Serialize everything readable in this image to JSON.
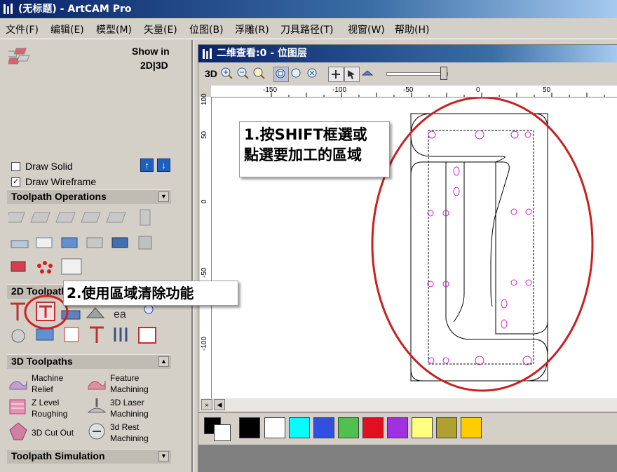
{
  "window": {
    "title": "(无标题) - ArtCAM Pro"
  },
  "menu": [
    "文件(F)",
    "编辑(E)",
    "模型(M)",
    "矢量(E)",
    "位图(B)",
    "浮雕(R)",
    "刀具路径(T)",
    "视窗(W)",
    "帮助(H)"
  ],
  "left_panel": {
    "show_in_label": "Show in",
    "show_in_value": "2D|3D",
    "draw_solid": {
      "label": "Draw Solid",
      "checked": false
    },
    "draw_wireframe": {
      "label": "Draw Wireframe",
      "checked": true
    },
    "sections": {
      "toolpath_operations": "Toolpath Operations",
      "toolpaths_2d": "2D Toolpaths",
      "toolpaths_3d": "3D Toolpaths",
      "toolpath_simulation": "Toolpath Simulation"
    },
    "toolpaths_3d_items": [
      {
        "label1": "Machine",
        "label2": "Relief"
      },
      {
        "label1": "Feature",
        "label2": "Machining"
      },
      {
        "label1": "Z Level",
        "label2": "Roughing"
      },
      {
        "label1": "3D Laser",
        "label2": "Machining"
      },
      {
        "label1": "3D Cut Out",
        "label2": ""
      },
      {
        "label1": "3d Rest",
        "label2": "Machining"
      }
    ]
  },
  "document": {
    "title": "二维查看:0 - 位图层",
    "toolbar_3d_label": "3D",
    "ruler_top_labels": [
      "-150",
      "-100",
      "-50",
      "0",
      "50"
    ],
    "ruler_left_labels": [
      "100",
      "50",
      "0",
      "-50",
      "-100"
    ]
  },
  "callouts": {
    "step1_line1": "1.按SHIFT框選或",
    "step1_line2": "點選要加工的區域",
    "step2": "2.使用區域清除功能"
  },
  "palette": {
    "colors": [
      "#000000",
      "#ffffff",
      "#00ffff",
      "#3050e0",
      "#50c050",
      "#e01020",
      "#a030e0",
      "#ffff80",
      "#b0a030",
      "#ffcc00"
    ]
  }
}
